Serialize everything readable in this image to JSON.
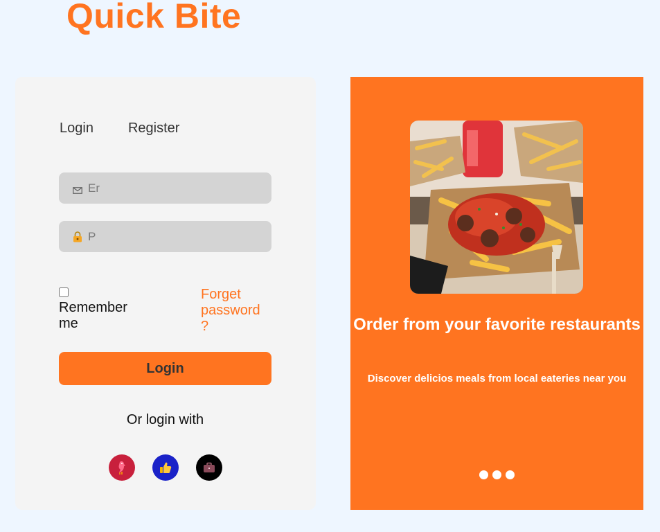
{
  "brand": {
    "name": "Quick Bite",
    "color": "#ff7420"
  },
  "auth": {
    "tabs": [
      {
        "label": "Login"
      },
      {
        "label": "Register"
      }
    ],
    "email": {
      "placeholder": "Er",
      "icon": "mail-icon"
    },
    "password": {
      "placeholder": "P",
      "icon": "lock-icon"
    },
    "remember_label": "Remember me",
    "forgot_label": "Forget password ?",
    "login_button": "Login",
    "or_login_with": "Or login with",
    "socials": [
      {
        "name": "social-1",
        "color": "#c8203c"
      },
      {
        "name": "social-2",
        "color": "#1a22c8"
      },
      {
        "name": "social-3",
        "color": "#000000"
      }
    ]
  },
  "promo": {
    "image_alt": "Food platter",
    "title": "Order from your favorite restaurants",
    "subtitle": "Discover delicios meals from local eateries near you",
    "slides": 3
  }
}
